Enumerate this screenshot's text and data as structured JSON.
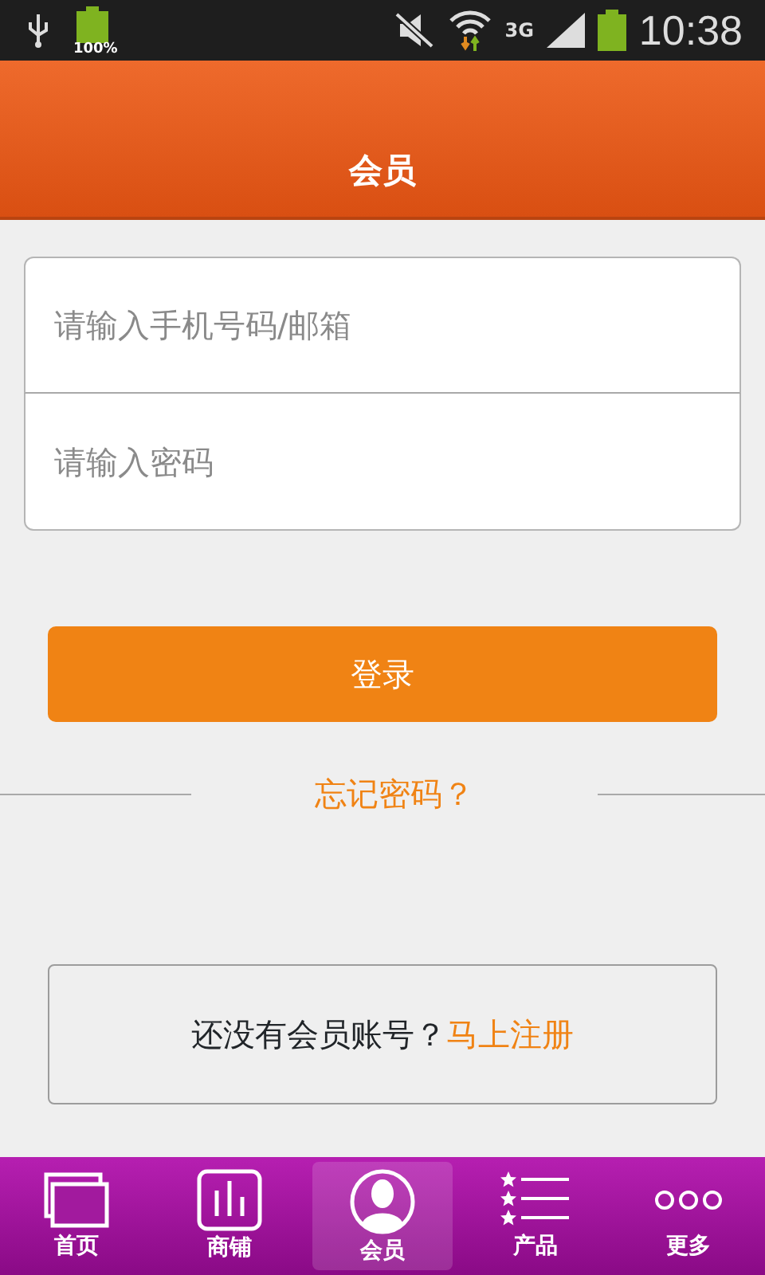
{
  "status_bar": {
    "battery_label": "100%",
    "network": "3G",
    "time": "10:38"
  },
  "header": {
    "title": "会员"
  },
  "login_form": {
    "fields": [
      {
        "placeholder": "请输入手机号码/邮箱"
      },
      {
        "placeholder": "请输入密码"
      }
    ],
    "submit": "登录",
    "forgot": "忘记密码？"
  },
  "register": {
    "prompt": "还没有会员账号？",
    "link": "马上注册"
  },
  "tab_bar": [
    {
      "kind": "home",
      "label": "首页",
      "selected": false
    },
    {
      "kind": "shop",
      "label": "商铺",
      "selected": false
    },
    {
      "kind": "member",
      "label": "会员",
      "selected": true
    },
    {
      "kind": "products",
      "label": "产品",
      "selected": false
    },
    {
      "kind": "more",
      "label": "更多",
      "selected": false
    }
  ]
}
